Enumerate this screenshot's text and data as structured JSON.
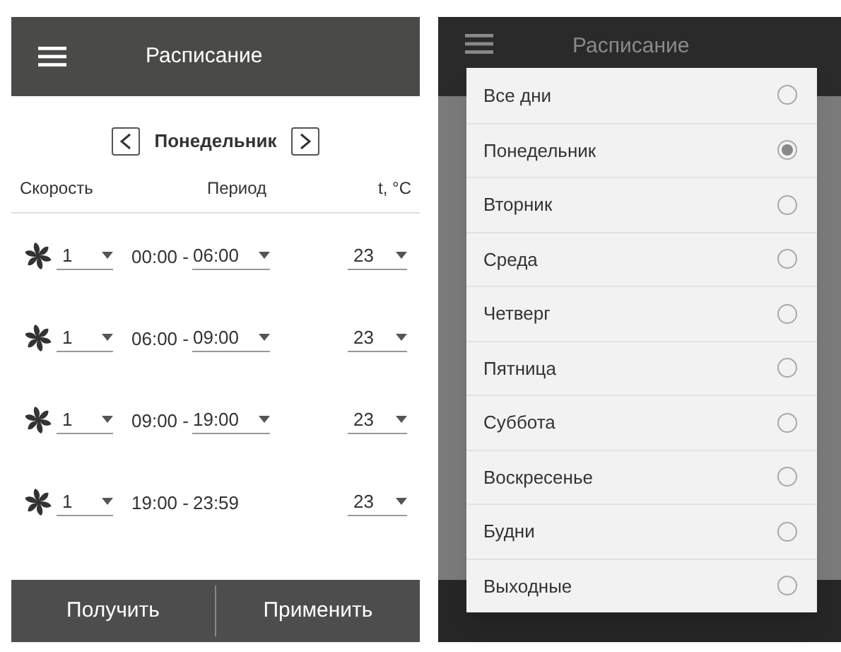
{
  "schedule_screen": {
    "title": "Расписание",
    "day": "Понедельник",
    "columns": [
      "Скорость",
      "Период",
      "t, °C"
    ],
    "rows": [
      {
        "speed": "1",
        "start": "00:00 -",
        "end": "06:00",
        "end_dropdown": true,
        "temperature": "23"
      },
      {
        "speed": "1",
        "start": "06:00 -",
        "end": "09:00",
        "end_dropdown": true,
        "temperature": "23"
      },
      {
        "speed": "1",
        "start": "09:00 -",
        "end": "19:00",
        "end_dropdown": true,
        "temperature": "23"
      },
      {
        "speed": "1",
        "start": "19:00 -",
        "end": "23:59",
        "end_dropdown": false,
        "temperature": "23"
      }
    ],
    "buttons": [
      "Получить",
      "Применить"
    ]
  },
  "day_picker_screen": {
    "title": "Расписание",
    "options": [
      {
        "label": "Все дни",
        "selected": false
      },
      {
        "label": "Понедельник",
        "selected": true
      },
      {
        "label": "Вторник",
        "selected": false
      },
      {
        "label": "Среда",
        "selected": false
      },
      {
        "label": "Четверг",
        "selected": false
      },
      {
        "label": "Пятница",
        "selected": false
      },
      {
        "label": "Суббота",
        "selected": false
      },
      {
        "label": "Воскресенье",
        "selected": false
      },
      {
        "label": "Будни",
        "selected": false
      },
      {
        "label": "Выходные",
        "selected": false
      }
    ]
  }
}
